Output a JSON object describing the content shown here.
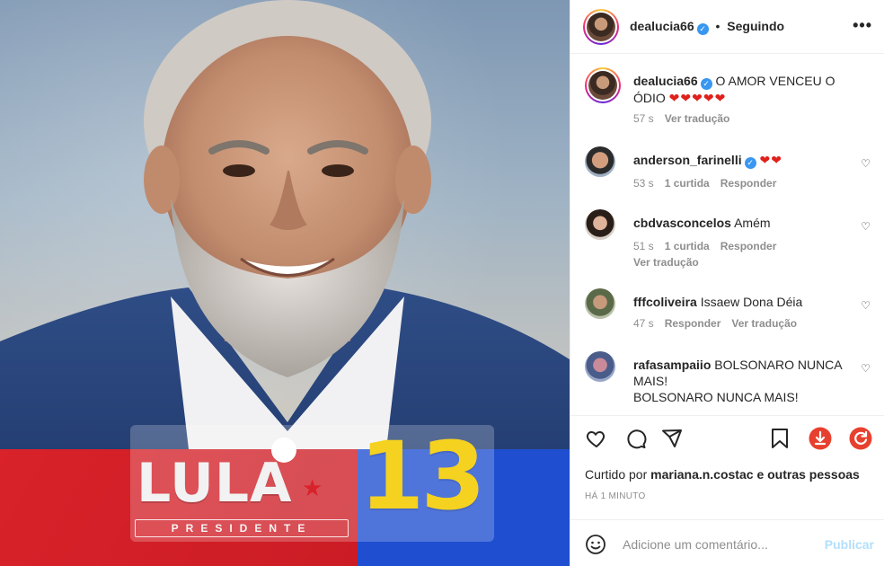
{
  "post": {
    "badge_name": "LULA",
    "badge_subtitle": "PRESIDENTE",
    "badge_number": "13"
  },
  "header": {
    "username": "dealucia66",
    "separator": "•",
    "follow_status": "Seguindo",
    "more_icon": "more-horizontal-icon"
  },
  "caption": {
    "username": "dealucia66",
    "text": "O AMOR VENCEU O ÓDIO",
    "hearts": "❤❤❤❤❤",
    "time": "57 s",
    "translate": "Ver tradução"
  },
  "comments": [
    {
      "username": "anderson_farinelli",
      "verified": true,
      "text": "",
      "hearts": "❤❤",
      "time": "53 s",
      "likes": "1 curtida",
      "reply": "Responder"
    },
    {
      "username": "cbdvasconcelos",
      "text": "Amém",
      "time": "51 s",
      "likes": "1 curtida",
      "reply": "Responder",
      "translate": "Ver tradução"
    },
    {
      "username": "fffcoliveira",
      "text": "Issaew Dona Déia",
      "time": "47 s",
      "reply": "Responder",
      "translate": "Ver tradução"
    },
    {
      "username": "rafasampaiio",
      "text": "BOLSONARO NUNCA MAIS!",
      "text2": "BOLSONARO NUNCA MAIS!"
    }
  ],
  "actions": {
    "like_icon": "heart-icon",
    "comment_icon": "comment-icon",
    "share_icon": "send-icon",
    "save_icon": "bookmark-icon",
    "download_icon": "download-icon",
    "repost_icon": "refresh-icon",
    "liked_prefix": "Curtido por",
    "liked_user": "mariana.n.costac",
    "liked_suffix": "e outras pessoas",
    "time_ago": "HÁ 1 MINUTO"
  },
  "add_comment": {
    "placeholder": "Adicione um comentário...",
    "publish": "Publicar",
    "emoji_icon": "smiley-icon"
  },
  "colors": {
    "red": "#d9222a",
    "blue": "#1f4fd0",
    "yellow": "#f5d21f",
    "verified": "#3897f0",
    "heart": "#e0201b",
    "download_btn": "#e8402e",
    "publish_disabled": "#b2dffc"
  }
}
